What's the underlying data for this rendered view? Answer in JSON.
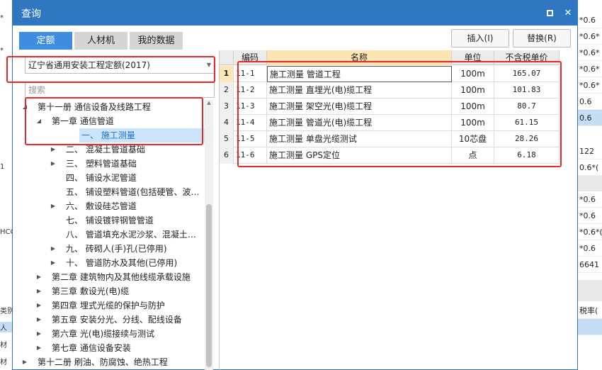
{
  "background": {
    "left_cells": [
      "*",
      "*",
      "1",
      "HCO",
      "类别",
      "人",
      "材",
      "材"
    ],
    "right_cells": [
      "*0.6",
      "*0.6*",
      "*0.6*",
      "*0.6*",
      "*0.6*",
      "0.6",
      "0.6",
      "122",
      "0.6*(",
      "*0.6",
      "*0.6",
      "*0.6*(",
      "*0.6",
      "6641",
      "税率("
    ]
  },
  "dialog": {
    "title": "查询",
    "maximize_icon": "maximize-icon",
    "close_icon": "close-icon",
    "close_glyph": "✕",
    "tabs": [
      {
        "label": "定额",
        "active": true
      },
      {
        "label": "人材机",
        "active": false
      },
      {
        "label": "我的数据",
        "active": false
      }
    ],
    "insert_button": "插入(I)",
    "replace_button": "替换(R)"
  },
  "left_panel": {
    "quota_select": "辽宁省通用安装工程定额(2017)",
    "search_placeholder": "搜索",
    "tree": [
      {
        "level": 0,
        "expander": "expanded",
        "label": "第十一册 通信设备及线路工程"
      },
      {
        "level": 1,
        "expander": "expanded",
        "label": "第一章 通信管道"
      },
      {
        "level": 2,
        "expander": "none",
        "label": "一、 施工测量",
        "selected": true
      },
      {
        "level": 2,
        "expander": "collapsed",
        "label": "二、 混凝土管道基础"
      },
      {
        "level": 2,
        "expander": "collapsed",
        "label": "三、 塑料管道基础"
      },
      {
        "level": 2,
        "expander": "none",
        "label": "四、 铺设水泥管道"
      },
      {
        "level": 2,
        "expander": "none",
        "label": "五、 铺设塑料管道(包括硬管、波…"
      },
      {
        "level": 2,
        "expander": "collapsed",
        "label": "六、 敷设硅芯管道"
      },
      {
        "level": 2,
        "expander": "none",
        "label": "七、 铺设镀锌钢管管道"
      },
      {
        "level": 2,
        "expander": "none",
        "label": "八、 管道填充水泥沙浆、混凝土…"
      },
      {
        "level": 2,
        "expander": "collapsed",
        "label": "九、 砖砌人(手)孔(已停用)"
      },
      {
        "level": 2,
        "expander": "collapsed",
        "label": "十、 管道防水及其他(已停用)"
      },
      {
        "level": 1,
        "expander": "collapsed",
        "label": "第二章 建筑物内及其他线缆承载设施"
      },
      {
        "level": 1,
        "expander": "collapsed",
        "label": "第三章 敷设光(电)缆"
      },
      {
        "level": 1,
        "expander": "collapsed",
        "label": "第四章 埋式光缆的保护与防护"
      },
      {
        "level": 1,
        "expander": "collapsed",
        "label": "第五章 安装分光、分线、配线设备"
      },
      {
        "level": 1,
        "expander": "collapsed",
        "label": "第六章 光(电)缆接续与测试"
      },
      {
        "level": 1,
        "expander": "collapsed",
        "label": "第七章 通信设备安装"
      },
      {
        "level": 0,
        "expander": "collapsed",
        "label": "第十二册 刷油、防腐蚀、绝热工程"
      }
    ]
  },
  "grid": {
    "headers": {
      "index": "",
      "code": "编码",
      "name": "名称",
      "unit": "单位",
      "price": "不含税单价"
    },
    "rows": [
      {
        "index": "1",
        "code": "11-1",
        "name": "施工测量 管道工程",
        "unit": "100m",
        "price": "165.07"
      },
      {
        "index": "2",
        "code": "11-2",
        "name": "施工测量 直埋光(电)缆工程",
        "unit": "100m",
        "price": "101.83"
      },
      {
        "index": "3",
        "code": "11-3",
        "name": "施工测量 架空光(电)缆工程",
        "unit": "100m",
        "price": "80.7"
      },
      {
        "index": "4",
        "code": "11-4",
        "name": "施工测量 管道光(电)缆工程",
        "unit": "100m",
        "price": "61.15"
      },
      {
        "index": "5",
        "code": "11-5",
        "name": "施工测量 单盘光缆测试",
        "unit": "10芯盘",
        "price": "28.26"
      },
      {
        "index": "6",
        "code": "11-6",
        "name": "施工测量 GPS定位",
        "unit": "点",
        "price": "6.18"
      }
    ]
  },
  "colors": {
    "title_bar": "#3077c2",
    "active_tab": "#3e8de0",
    "highlight_box": "#e52a2a",
    "selected_tree_row": "#cce4f7",
    "name_header": "#fde5b3"
  }
}
